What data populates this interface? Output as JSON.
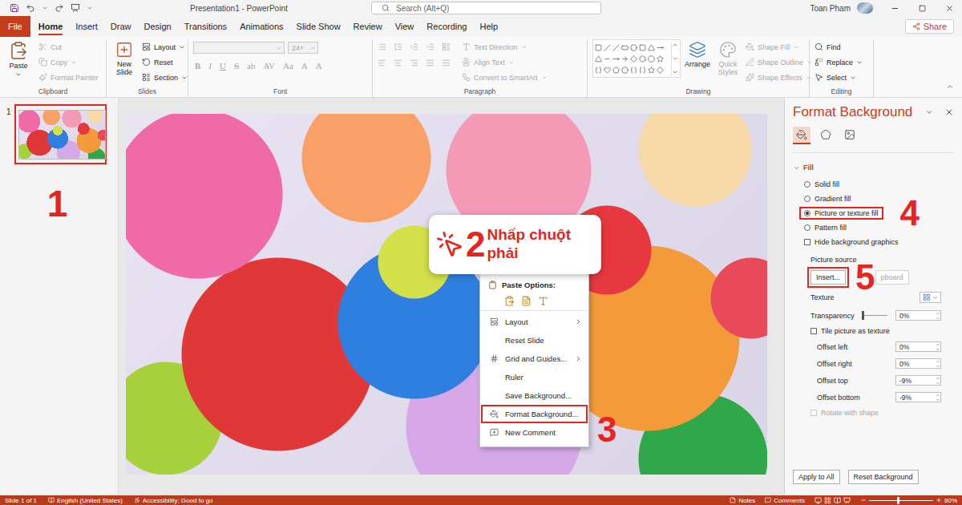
{
  "title_bar": {
    "title": "Presentation1 - PowerPoint",
    "search_placeholder": "Search (Alt+Q)",
    "user": "Toan Pham"
  },
  "ribbon_tabs": [
    {
      "label": "File",
      "selected": false
    },
    {
      "label": "Home",
      "selected": true
    },
    {
      "label": "Insert",
      "selected": false
    },
    {
      "label": "Draw",
      "selected": false
    },
    {
      "label": "Design",
      "selected": false
    },
    {
      "label": "Transitions",
      "selected": false
    },
    {
      "label": "Animations",
      "selected": false
    },
    {
      "label": "Slide Show",
      "selected": false
    },
    {
      "label": "Review",
      "selected": false
    },
    {
      "label": "View",
      "selected": false
    },
    {
      "label": "Recording",
      "selected": false
    },
    {
      "label": "Help",
      "selected": false
    }
  ],
  "share_button": "Share",
  "ribbon": {
    "clipboard": {
      "label": "Clipboard",
      "paste": {
        "label": "Paste",
        "disabled": false
      },
      "items": [
        {
          "label": "Cut",
          "disabled": true
        },
        {
          "label": "Copy",
          "disabled": true
        },
        {
          "label": "Format Painter",
          "disabled": true
        }
      ]
    },
    "slides": {
      "label": "Slides",
      "new_slide": {
        "label": "New Slide",
        "disabled": false
      },
      "items": [
        {
          "label": "Layout",
          "disabled": false
        },
        {
          "label": "Reset",
          "disabled": false
        },
        {
          "label": "Section",
          "disabled": false
        }
      ]
    },
    "font": {
      "label": "Font",
      "font_size": "24+",
      "disabled": true,
      "buttons": [
        "B",
        "I",
        "U",
        "S",
        "ab",
        "AV",
        "Aa",
        "A",
        "A"
      ]
    },
    "paragraph": {
      "label": "Paragraph",
      "disabled": true,
      "items": [
        {
          "label": "Text Direction",
          "disabled": true
        },
        {
          "label": "Align Text",
          "disabled": true
        },
        {
          "label": "Convert to SmartArt",
          "disabled": true
        }
      ]
    },
    "drawing": {
      "label": "Drawing",
      "arrange": {
        "label": "Arrange",
        "disabled": false
      },
      "quick_styles": {
        "label": "Quick Styles",
        "disabled": true
      },
      "items": [
        {
          "label": "Shape Fill",
          "disabled": true
        },
        {
          "label": "Shape Outline",
          "disabled": true
        },
        {
          "label": "Shape Effects",
          "disabled": true
        }
      ]
    },
    "editing": {
      "label": "Editing",
      "items": [
        {
          "label": "Find",
          "disabled": false
        },
        {
          "label": "Replace",
          "disabled": false
        },
        {
          "label": "Select",
          "disabled": false
        }
      ]
    }
  },
  "thumbnails": [
    {
      "number": "1",
      "selected": true,
      "highlighted": true,
      "marker": "1"
    }
  ],
  "callout": {
    "marker": "2",
    "text": "Nhấp chuột phải"
  },
  "context_menu": {
    "paste_label": "Paste Options:",
    "items": [
      {
        "label": "Layout",
        "submenu": true,
        "highlighted": false
      },
      {
        "label": "Reset Slide",
        "submenu": false,
        "highlighted": false
      },
      {
        "label": "Grid and Guides...",
        "submenu": true,
        "highlighted": false
      },
      {
        "label": "Ruler",
        "submenu": false,
        "highlighted": false
      },
      {
        "label": "Save Background...",
        "submenu": false,
        "highlighted": false
      },
      {
        "label": "Format Background...",
        "submenu": false,
        "highlighted": true,
        "marker": "3"
      },
      {
        "label": "New Comment",
        "submenu": false,
        "highlighted": false
      }
    ]
  },
  "format_pane": {
    "title": "Format Background",
    "tabs": [
      {
        "selected": true
      },
      {
        "selected": false
      },
      {
        "selected": false
      }
    ],
    "section": {
      "label": "Fill",
      "expanded": true
    },
    "fill_options": [
      {
        "label": "Solid fill",
        "selected": false,
        "highlighted": false
      },
      {
        "label": "Gradient fill",
        "selected": false,
        "highlighted": false
      },
      {
        "label": "Picture or texture fill",
        "selected": true,
        "highlighted": true,
        "marker": "4"
      },
      {
        "label": "Pattern fill",
        "selected": false,
        "highlighted": false
      }
    ],
    "hide_background": {
      "label": "Hide background graphics",
      "checked": false
    },
    "picture_source": {
      "label": "Picture source",
      "insert": {
        "label": "Insert...",
        "highlighted": true,
        "marker": "5"
      },
      "clipboard": {
        "label": "pboard",
        "disabled": true
      }
    },
    "texture": {
      "label": "Texture"
    },
    "transparency": {
      "label": "Transparency",
      "level": 0,
      "reading": "0%"
    },
    "tile": {
      "label": "Tile picture as texture",
      "checked": false
    },
    "offsets": [
      {
        "label": "Offset left",
        "value": "0%"
      },
      {
        "label": "Offset right",
        "value": "0%"
      },
      {
        "label": "Offset top",
        "value": "-9%"
      },
      {
        "label": "Offset bottom",
        "value": "-9%"
      }
    ],
    "rotate": {
      "label": "Rotate with shape",
      "checked": false,
      "disabled": true
    },
    "buttons": [
      "Apply to All",
      "Reset Background"
    ]
  },
  "status_bar": {
    "slide": "Slide 1 of 1",
    "language": "English (United States)",
    "accessibility": "Accessibility: Good to go",
    "notes": "Notes",
    "comments": "Comments",
    "zoom": {
      "level": 0.45,
      "reading": "80%"
    }
  }
}
